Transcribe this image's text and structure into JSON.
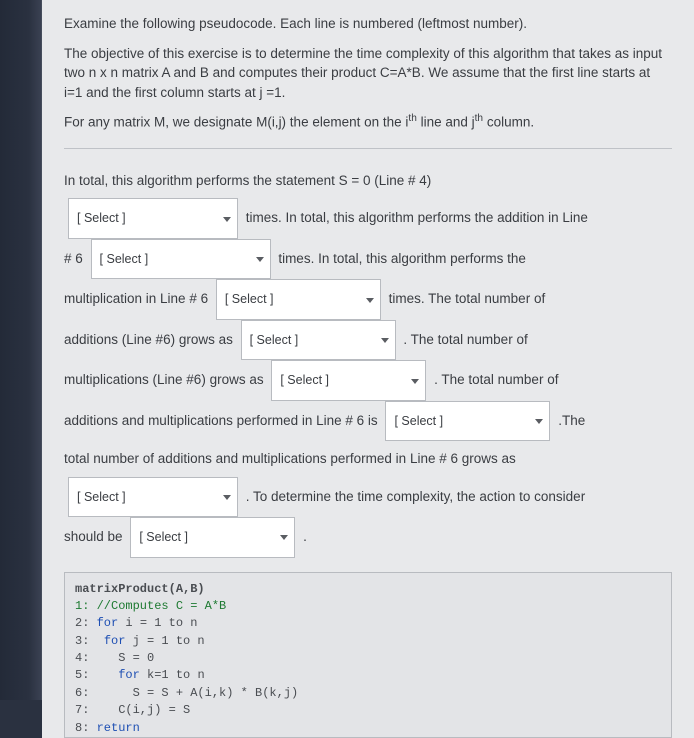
{
  "intro": {
    "p1": "Examine the following pseudocode. Each line is numbered (leftmost number).",
    "p2": "The objective of this exercise is to determine the time complexity of this algorithm that takes as input two n x n matrix A and B  and computes their product C=A*B. We assume that the first line starts at i=1 and the first column starts at j =1.",
    "p3_a": "For any matrix M, we designate M(i,j) the element on the i",
    "p3_b": " line and j",
    "p3_c": " column."
  },
  "sup_th": "th",
  "flow": {
    "t1": "In total, this algorithm performs the statement S = 0 (Line # 4)",
    "t2": "times. In total, this algorithm performs the addition in Line",
    "t3a": "# 6",
    "t3b": "times. In total, this algorithm performs the",
    "t4a": "multiplication in Line # 6",
    "t4b": "times. The total number of",
    "t5a": "additions (Line #6) grows as",
    "t5b": ". The total number of",
    "t6a": "multiplications (Line #6) grows as",
    "t6b": ". The total number of",
    "t7a": "additions and multiplications performed in Line # 6 is",
    "t7b": ".The",
    "t8": "total number of additions and multiplications performed in Line # 6 grows as",
    "t9": ". To determine the time complexity, the action to consider",
    "t10a": "should be",
    "t10b": "."
  },
  "select_label": "[ Select ]",
  "code": {
    "title": "matrixProduct(A,B)",
    "l1": "1: //Computes C = A*B",
    "l2a": "2: ",
    "l2b": "for",
    "l2c": " i = 1 to n",
    "l3a": "3:  ",
    "l3b": "for",
    "l3c": " j = 1 to n",
    "l4": "4:    S = 0",
    "l5a": "5:    ",
    "l5b": "for",
    "l5c": " k=1 to n",
    "l6": "6:      S = S + A(i,k) * B(k,j)",
    "l7": "7:    C(i,j) = S",
    "l8a": "8: ",
    "l8b": "return"
  }
}
